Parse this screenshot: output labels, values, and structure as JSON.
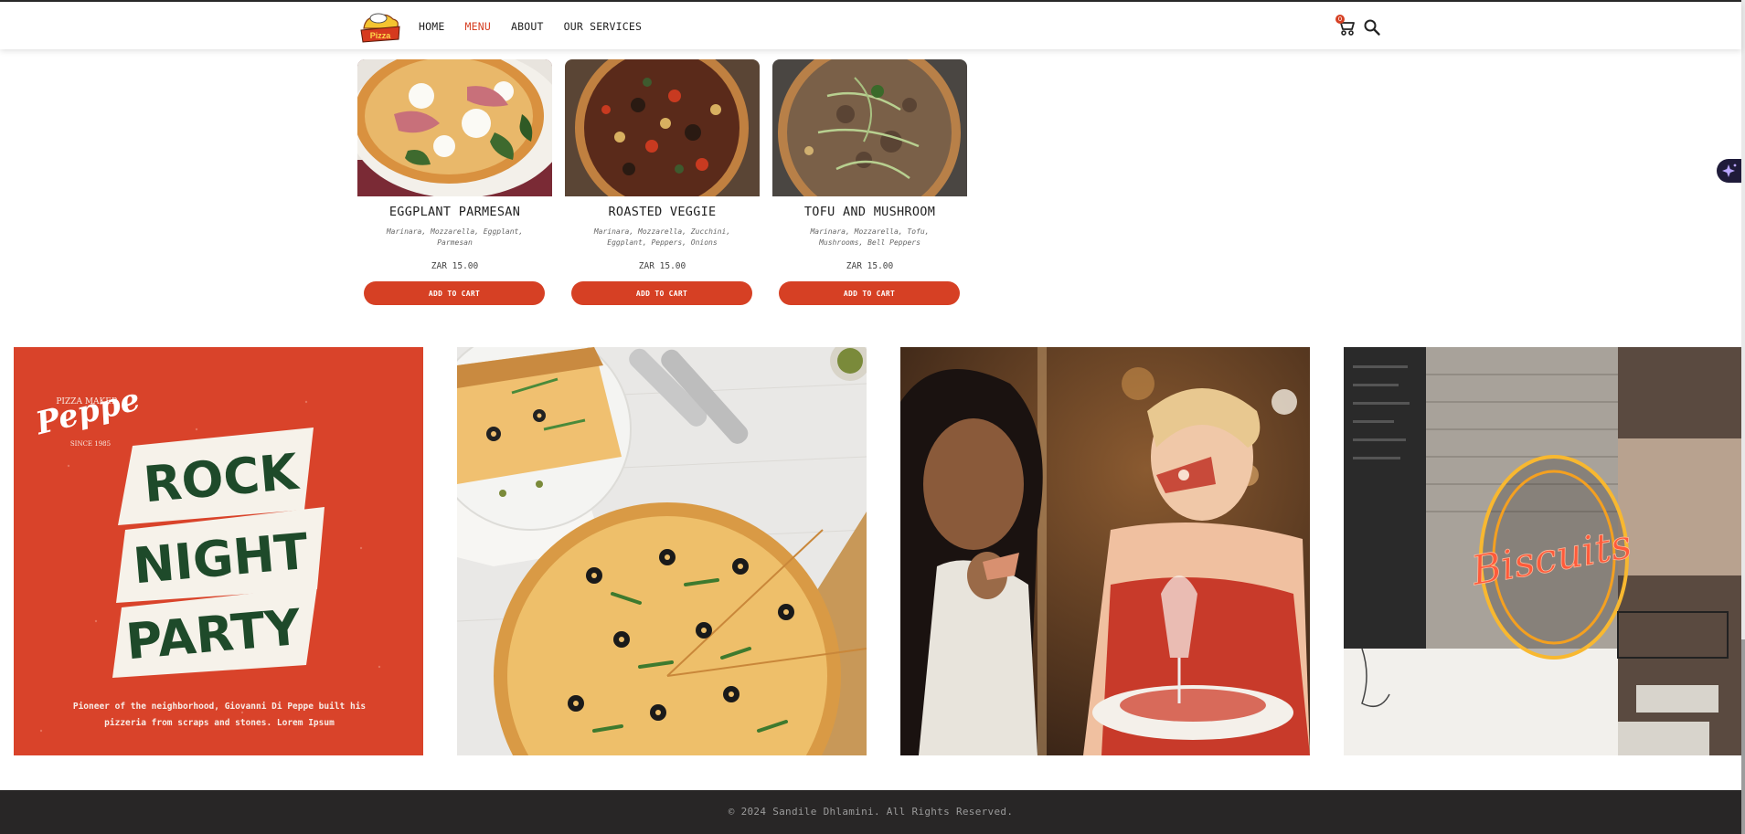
{
  "nav": {
    "logo_text": "Pizza",
    "links": [
      {
        "label": "HOME"
      },
      {
        "label": "MENU"
      },
      {
        "label": "ABOUT"
      },
      {
        "label": "OUR SERVICES"
      }
    ],
    "active_index": 1,
    "cart_count": "0"
  },
  "products": [
    {
      "title": "EGGPLANT PARMESAN",
      "description": "Marinara, Mozzarella, Eggplant, Parmesan",
      "price": "ZAR 15.00",
      "button": "ADD TO CART"
    },
    {
      "title": "ROASTED VEGGIE",
      "description": "Marinara, Mozzarella, Zucchini, Eggplant, Peppers, Onions",
      "price": "ZAR 15.00",
      "button": "ADD TO CART"
    },
    {
      "title": "TOFU AND MUSHROOM",
      "description": "Marinara, Mozzarella, Tofu, Mushrooms, Bell Peppers",
      "price": "ZAR 15.00",
      "button": "ADD TO CART"
    }
  ],
  "gallery": {
    "poster": {
      "brand": "Peppe",
      "brand_sub_top": "PIZZA MAKER",
      "brand_sub_bottom": "SINCE 1985",
      "line1": "ROCK",
      "line2": "NIGHT",
      "line3": "PARTY",
      "caption": "Pioneer of the neighborhood, Giovanni Di Peppe built his pizzeria from scraps and stones. Lorem Ipsum"
    },
    "neon_sign": "Biscuits"
  },
  "footer": {
    "copyright": "© 2024 Sandile Dhlamini. All Rights Reserved."
  },
  "colors": {
    "accent": "#d64024",
    "footer_bg": "#282626",
    "poster_bg": "#d9432a",
    "poster_text": "#1e4a2a"
  }
}
